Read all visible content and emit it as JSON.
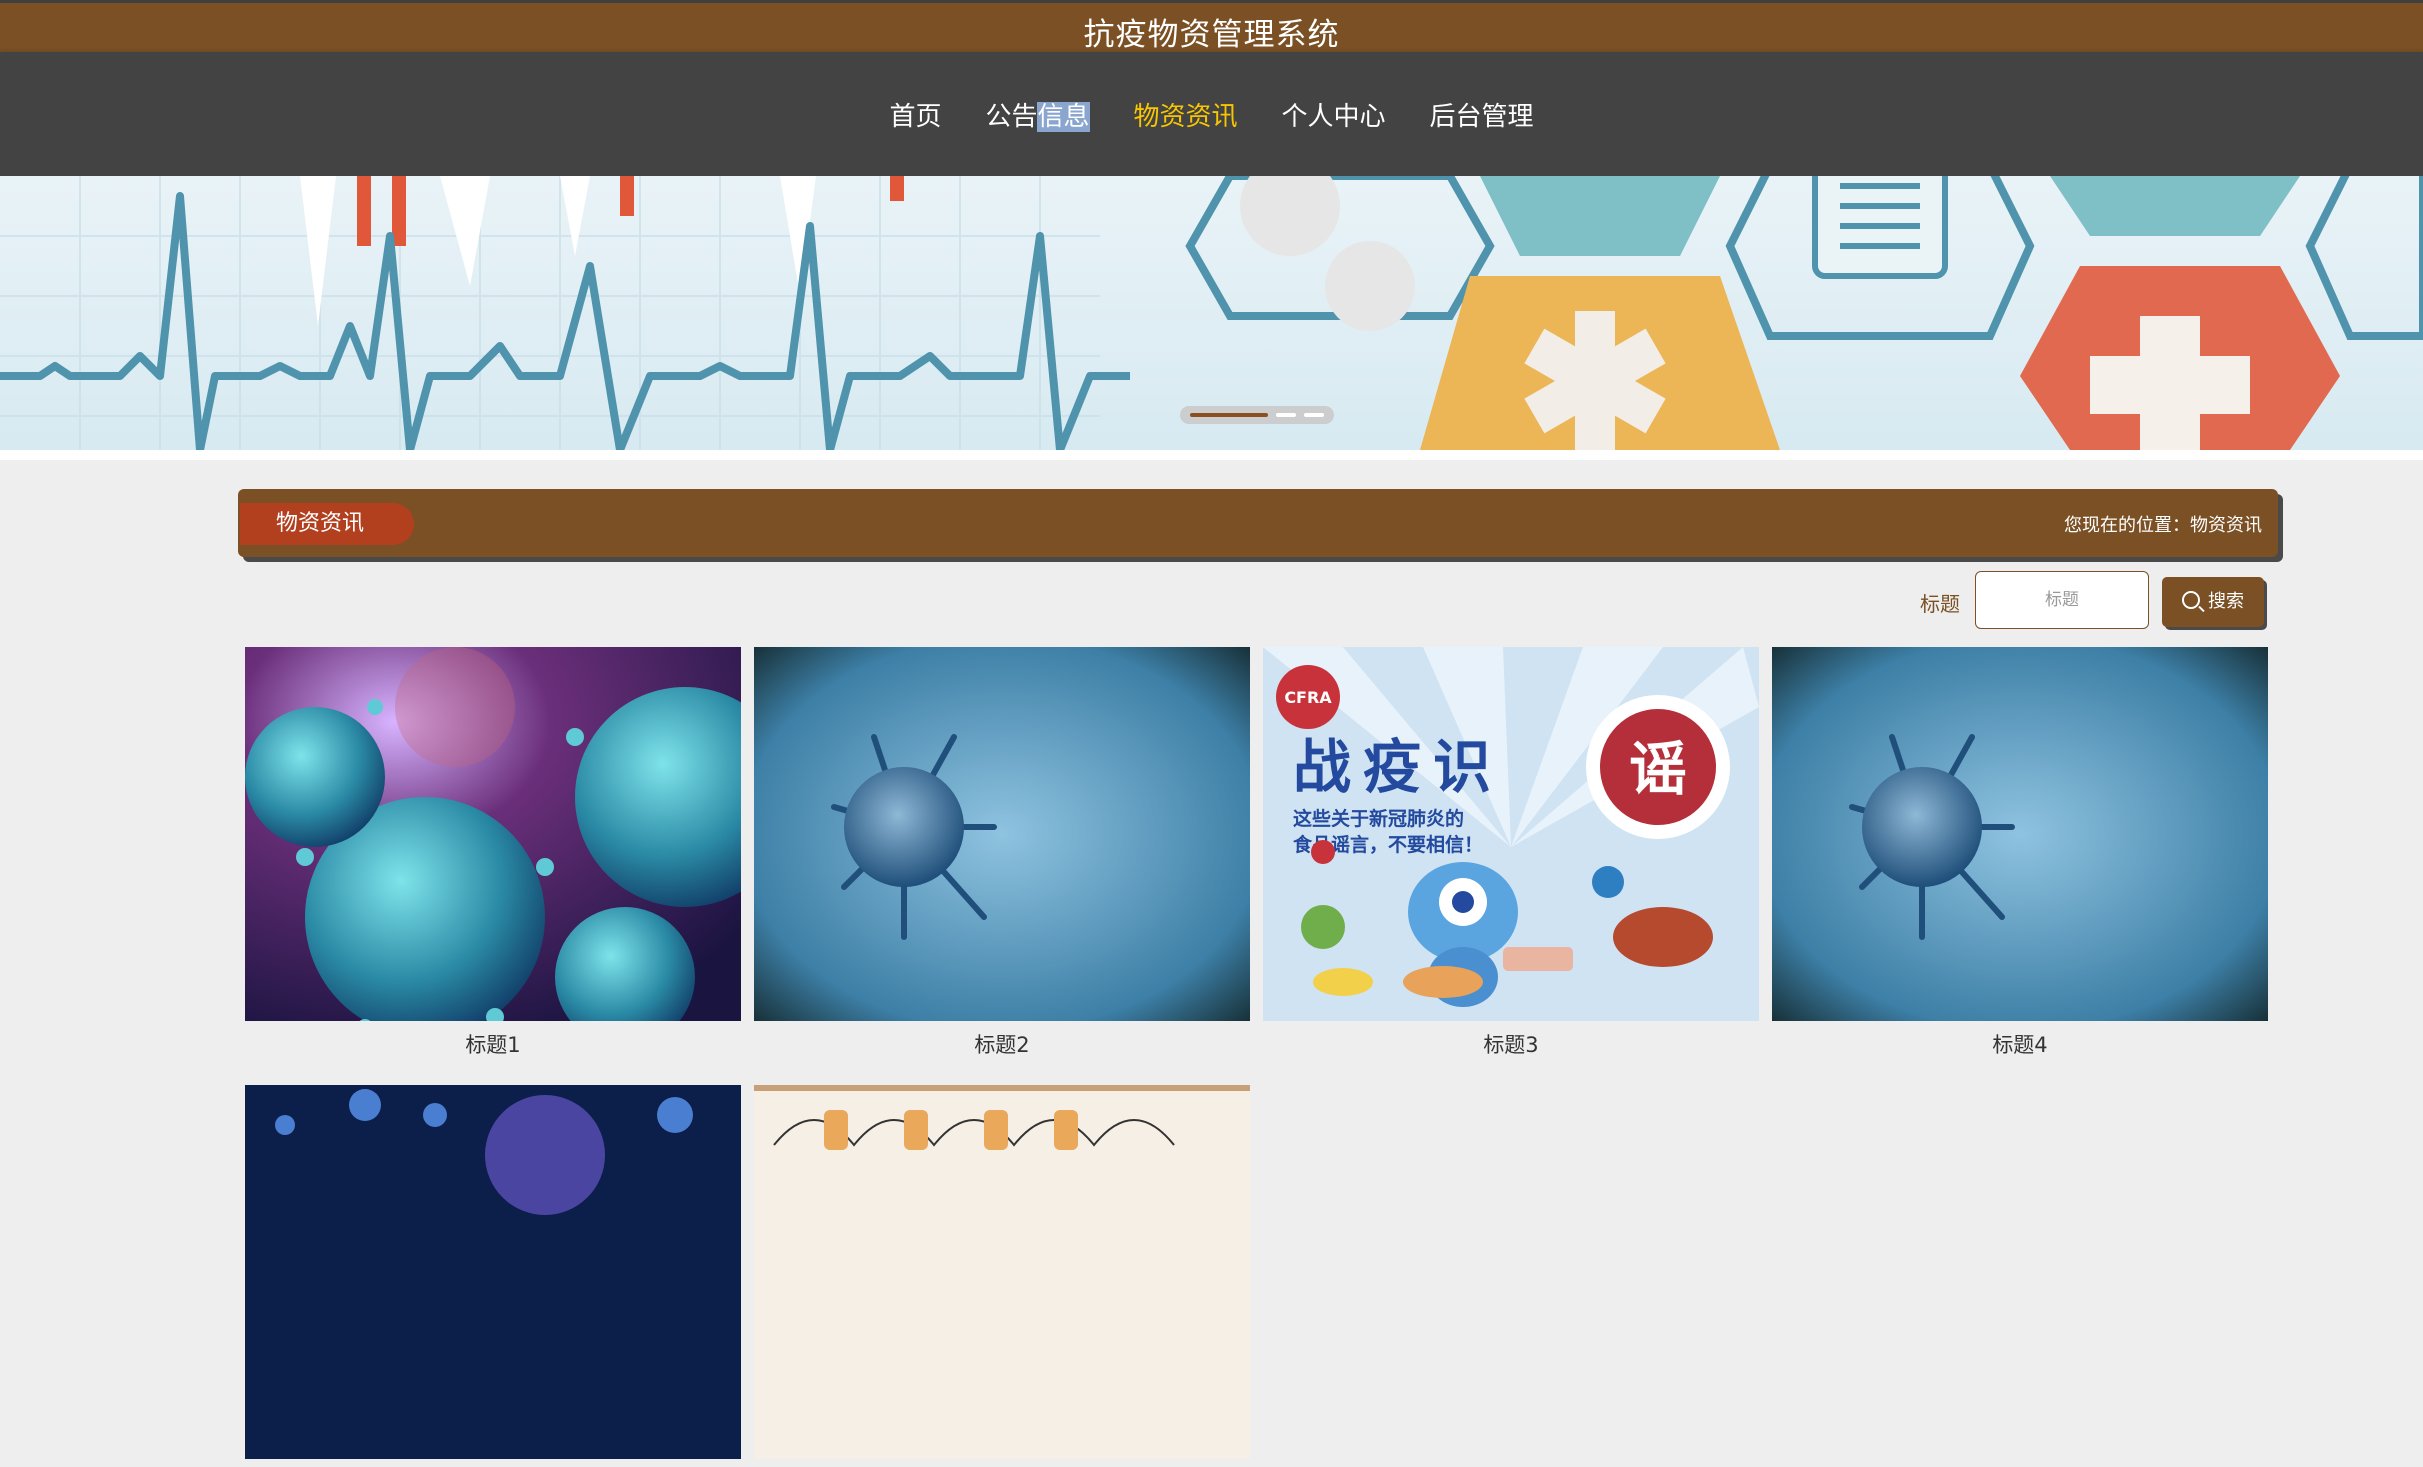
{
  "header": {
    "title": "抗疫物资管理系统"
  },
  "nav": {
    "items": [
      {
        "label": "首页"
      },
      {
        "label_a": "公告",
        "label_b": "信息"
      },
      {
        "label": "物资资讯"
      },
      {
        "label": "个人中心"
      },
      {
        "label": "后台管理"
      }
    ],
    "active_index": 2
  },
  "banner": {
    "slides": 3,
    "active_slide": 0
  },
  "section": {
    "title": "物资资讯",
    "location_label": "您现在的位置：",
    "location_value": "物资资讯"
  },
  "search": {
    "label": "标题",
    "placeholder": "标题",
    "value": "",
    "button_label": "搜索",
    "button_icon": "search-icon"
  },
  "items": [
    {
      "title": "标题1",
      "image": "coronavirus-red-background"
    },
    {
      "title": "标题2",
      "image": "single-virus-blue-blur"
    },
    {
      "title": "标题3",
      "image": "poster-food-rumors"
    },
    {
      "title": "标题4",
      "image": "single-virus-blue-blur"
    },
    {
      "title": "",
      "image": "virus-dark-blue"
    },
    {
      "title": "",
      "image": "hand-drawn-poster"
    }
  ],
  "poster": {
    "org": "CFRA",
    "headline_a": "战",
    "headline_b": "疫",
    "headline_c": "识",
    "stamp": "谣",
    "line1": "这些关于新冠肺炎的",
    "line2": "食品谣言，不要相信！"
  },
  "colors": {
    "brand_brown": "#7a5024",
    "nav_bg": "#434343",
    "nav_active": "#f7c600",
    "badge_red": "#b2401f",
    "page_bg": "#eeeeee"
  }
}
